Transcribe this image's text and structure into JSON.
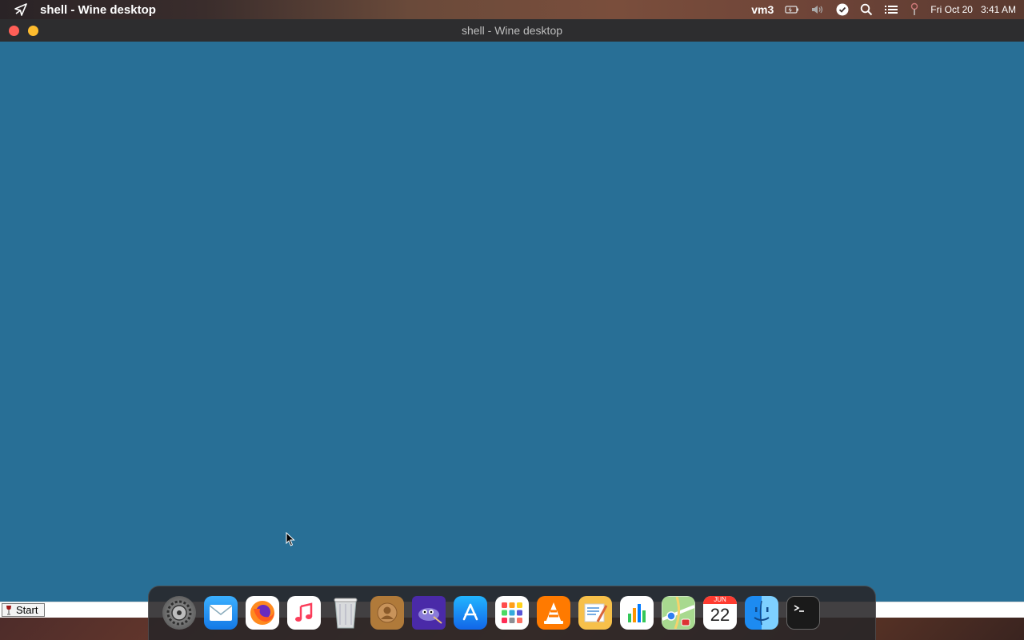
{
  "menubar": {
    "app_title": "shell - Wine desktop",
    "hostname": "vm3",
    "date": "Fri Oct 20",
    "time": "3:41 AM",
    "icons": [
      "launcher-icon",
      "battery-icon",
      "volume-icon",
      "check-circle-icon",
      "search-icon",
      "list-icon",
      "location-pin-icon"
    ]
  },
  "window": {
    "title": "shell - Wine desktop",
    "background_color": "#286f96"
  },
  "taskbar": {
    "start_label": "Start"
  },
  "dock": {
    "items": [
      {
        "name": "System Preferences",
        "icon": "gear-icon"
      },
      {
        "name": "Mail",
        "icon": "mail-icon"
      },
      {
        "name": "Firefox",
        "icon": "firefox-icon"
      },
      {
        "name": "Music",
        "icon": "music-icon"
      },
      {
        "name": "Trash",
        "icon": "trash-icon"
      },
      {
        "name": "Contacts",
        "icon": "contacts-icon"
      },
      {
        "name": "GIMP",
        "icon": "gimp-icon"
      },
      {
        "name": "App Store",
        "icon": "app-store-icon"
      },
      {
        "name": "Launchpad",
        "icon": "launchpad-icon"
      },
      {
        "name": "VLC",
        "icon": "vlc-icon"
      },
      {
        "name": "TextEdit",
        "icon": "textedit-icon"
      },
      {
        "name": "Numbers",
        "icon": "chart-icon"
      },
      {
        "name": "Maps",
        "icon": "maps-icon"
      },
      {
        "name": "Calendar",
        "icon": "calendar-icon",
        "month": "JUN",
        "day": "22"
      },
      {
        "name": "Finder",
        "icon": "finder-icon"
      },
      {
        "name": "Terminal",
        "icon": "terminal-icon"
      }
    ]
  }
}
